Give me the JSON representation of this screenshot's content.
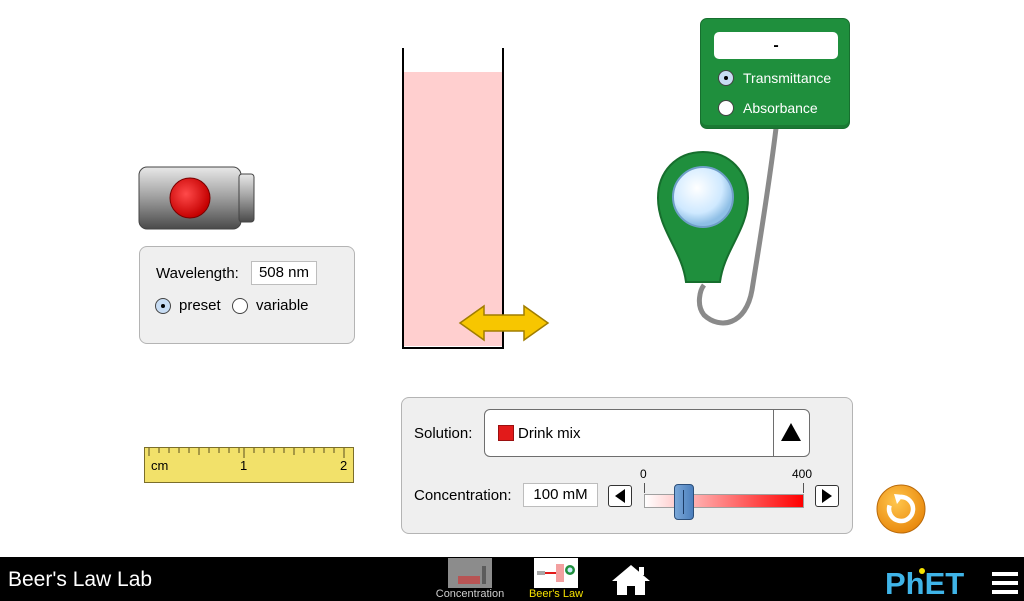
{
  "wavelength": {
    "label": "Wavelength:",
    "value": "508 nm",
    "options": [
      "preset",
      "variable"
    ],
    "selected": "preset"
  },
  "detector": {
    "display": "-",
    "modes": [
      "Transmittance",
      "Absorbance"
    ],
    "selected": "Transmittance"
  },
  "ruler": {
    "unit": "cm",
    "ticks": [
      "1",
      "2"
    ]
  },
  "solution": {
    "label": "Solution:",
    "selected": "Drink mix",
    "swatch_color": "#e21a1a"
  },
  "concentration": {
    "label": "Concentration:",
    "value": "100 mM",
    "min_label": "0",
    "max_label": "400",
    "fraction": 0.25
  },
  "colors": {
    "solution_fill": "#ffcfcf",
    "detector_green": "#1f8f3d",
    "arrow_yellow": "#f7c600",
    "reset_orange": "#f6a11a"
  },
  "navbar": {
    "title": "Beer's Law Lab",
    "screens": [
      {
        "label": "Concentration",
        "active": false
      },
      {
        "label": "Beer's Law",
        "active": true
      }
    ],
    "home_icon": "home-icon",
    "logo": "PhET",
    "menu_icon": "hamburger-icon"
  }
}
